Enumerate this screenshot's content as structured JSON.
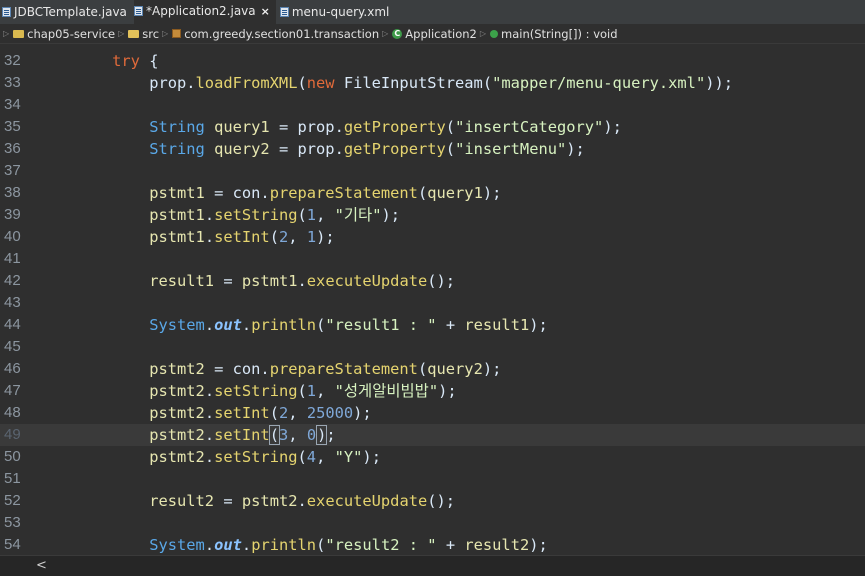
{
  "tabs": [
    {
      "label": "JDBCTemplate.java",
      "active": false,
      "closable": false
    },
    {
      "label": "*Application2.java",
      "active": true,
      "closable": true,
      "close_glyph": "×"
    },
    {
      "label": "menu-query.xml",
      "active": false,
      "closable": false
    }
  ],
  "breadcrumb": [
    {
      "label": "chap05-service",
      "icon": "project-icon"
    },
    {
      "label": "src",
      "icon": "source-folder-icon"
    },
    {
      "label": "com.greedy.section01.transaction",
      "icon": "package-icon"
    },
    {
      "label": "Application2",
      "icon": "class-icon"
    },
    {
      "label": "main(String[]) : void",
      "icon": "method-icon"
    }
  ],
  "editor": {
    "current_line": "49",
    "lines": [
      {
        "n": "32",
        "tokens": [
          [
            "",
            "        "
          ],
          [
            "kw",
            "try"
          ],
          [
            "",
            " {"
          ]
        ]
      },
      {
        "n": "33",
        "tokens": [
          [
            "",
            "            prop."
          ],
          [
            "meth",
            "loadFromXML"
          ],
          [
            "",
            "("
          ],
          [
            "kw",
            "new"
          ],
          [
            "",
            " FileInputStream("
          ],
          [
            "str",
            "\"mapper/menu-query.xml\""
          ],
          [
            "",
            "));"
          ]
        ]
      },
      {
        "n": "34",
        "tokens": []
      },
      {
        "n": "35",
        "tokens": [
          [
            "",
            "            "
          ],
          [
            "type",
            "String"
          ],
          [
            "",
            " "
          ],
          [
            "var",
            "query1"
          ],
          [
            "",
            " = prop."
          ],
          [
            "meth",
            "getProperty"
          ],
          [
            "",
            "("
          ],
          [
            "str",
            "\"insertCategory\""
          ],
          [
            "",
            ");"
          ]
        ]
      },
      {
        "n": "36",
        "tokens": [
          [
            "",
            "            "
          ],
          [
            "type",
            "String"
          ],
          [
            "",
            " "
          ],
          [
            "var",
            "query2"
          ],
          [
            "",
            " = prop."
          ],
          [
            "meth",
            "getProperty"
          ],
          [
            "",
            "("
          ],
          [
            "str",
            "\"insertMenu\""
          ],
          [
            "",
            ");"
          ]
        ]
      },
      {
        "n": "37",
        "tokens": []
      },
      {
        "n": "38",
        "tokens": [
          [
            "",
            "            "
          ],
          [
            "var",
            "pstmt1"
          ],
          [
            "",
            " = con."
          ],
          [
            "meth",
            "prepareStatement"
          ],
          [
            "",
            "("
          ],
          [
            "var",
            "query1"
          ],
          [
            "",
            ");"
          ]
        ]
      },
      {
        "n": "39",
        "tokens": [
          [
            "",
            "            "
          ],
          [
            "var",
            "pstmt1"
          ],
          [
            "",
            "."
          ],
          [
            "meth",
            "setString"
          ],
          [
            "",
            "("
          ],
          [
            "num",
            "1"
          ],
          [
            "",
            ", "
          ],
          [
            "str",
            "\"기타\""
          ],
          [
            "",
            ");"
          ]
        ]
      },
      {
        "n": "40",
        "tokens": [
          [
            "",
            "            "
          ],
          [
            "var",
            "pstmt1"
          ],
          [
            "",
            "."
          ],
          [
            "meth",
            "setInt"
          ],
          [
            "",
            "("
          ],
          [
            "num",
            "2"
          ],
          [
            "",
            ", "
          ],
          [
            "num",
            "1"
          ],
          [
            "",
            ");"
          ]
        ]
      },
      {
        "n": "41",
        "tokens": []
      },
      {
        "n": "42",
        "tokens": [
          [
            "",
            "            "
          ],
          [
            "var",
            "result1"
          ],
          [
            "",
            " = "
          ],
          [
            "var",
            "pstmt1"
          ],
          [
            "",
            "."
          ],
          [
            "meth",
            "executeUpdate"
          ],
          [
            "",
            "();"
          ]
        ]
      },
      {
        "n": "43",
        "tokens": []
      },
      {
        "n": "44",
        "tokens": [
          [
            "",
            "            "
          ],
          [
            "type",
            "System"
          ],
          [
            "",
            "."
          ],
          [
            "fld",
            "out"
          ],
          [
            "",
            "."
          ],
          [
            "meth",
            "println"
          ],
          [
            "",
            "("
          ],
          [
            "str",
            "\"result1 : \""
          ],
          [
            "",
            " + "
          ],
          [
            "var",
            "result1"
          ],
          [
            "",
            ");"
          ]
        ]
      },
      {
        "n": "45",
        "tokens": []
      },
      {
        "n": "46",
        "tokens": [
          [
            "",
            "            "
          ],
          [
            "var",
            "pstmt2"
          ],
          [
            "",
            " = con."
          ],
          [
            "meth",
            "prepareStatement"
          ],
          [
            "",
            "("
          ],
          [
            "var",
            "query2"
          ],
          [
            "",
            ");"
          ]
        ]
      },
      {
        "n": "47",
        "tokens": [
          [
            "",
            "            "
          ],
          [
            "var",
            "pstmt2"
          ],
          [
            "",
            "."
          ],
          [
            "meth",
            "setString"
          ],
          [
            "",
            "("
          ],
          [
            "num",
            "1"
          ],
          [
            "",
            ", "
          ],
          [
            "str",
            "\"성게알비빔밥\""
          ],
          [
            "",
            ");"
          ]
        ]
      },
      {
        "n": "48",
        "tokens": [
          [
            "",
            "            "
          ],
          [
            "var",
            "pstmt2"
          ],
          [
            "",
            "."
          ],
          [
            "meth",
            "setInt"
          ],
          [
            "",
            "("
          ],
          [
            "num",
            "2"
          ],
          [
            "",
            ", "
          ],
          [
            "num",
            "25000"
          ],
          [
            "",
            ");"
          ]
        ]
      },
      {
        "n": "49",
        "tokens": [
          [
            "",
            "            "
          ],
          [
            "var",
            "pstmt2"
          ],
          [
            "",
            "."
          ],
          [
            "meth",
            "setInt"
          ],
          [
            "box",
            "("
          ],
          [
            "num",
            "3"
          ],
          [
            "",
            ", "
          ],
          [
            "num",
            "0"
          ],
          [
            "caret",
            ""
          ],
          [
            "box",
            ")"
          ],
          [
            "",
            ";"
          ]
        ]
      },
      {
        "n": "50",
        "tokens": [
          [
            "",
            "            "
          ],
          [
            "var",
            "pstmt2"
          ],
          [
            "",
            "."
          ],
          [
            "meth",
            "setString"
          ],
          [
            "",
            "("
          ],
          [
            "num",
            "4"
          ],
          [
            "",
            ", "
          ],
          [
            "str",
            "\"Y\""
          ],
          [
            "",
            ");"
          ]
        ]
      },
      {
        "n": "51",
        "tokens": []
      },
      {
        "n": "52",
        "tokens": [
          [
            "",
            "            "
          ],
          [
            "var",
            "result2"
          ],
          [
            "",
            " = "
          ],
          [
            "var",
            "pstmt2"
          ],
          [
            "",
            "."
          ],
          [
            "meth",
            "executeUpdate"
          ],
          [
            "",
            "();"
          ]
        ]
      },
      {
        "n": "53",
        "tokens": []
      },
      {
        "n": "54",
        "tokens": [
          [
            "",
            "            "
          ],
          [
            "type",
            "System"
          ],
          [
            "",
            "."
          ],
          [
            "fld",
            "out"
          ],
          [
            "",
            "."
          ],
          [
            "meth",
            "println"
          ],
          [
            "",
            "("
          ],
          [
            "str",
            "\"result2 : \""
          ],
          [
            "",
            " + "
          ],
          [
            "var",
            "result2"
          ],
          [
            "",
            ");"
          ]
        ]
      }
    ]
  },
  "scrollbar": {
    "left_arrow": "<"
  },
  "colors": {
    "background": "#2f2f2f",
    "keyword": "#e06a3a",
    "string": "#d7f2c0",
    "number": "#7fa8d8",
    "method": "#e5d46f",
    "type": "#5aa8e8",
    "variable": "#e6e6b0"
  }
}
